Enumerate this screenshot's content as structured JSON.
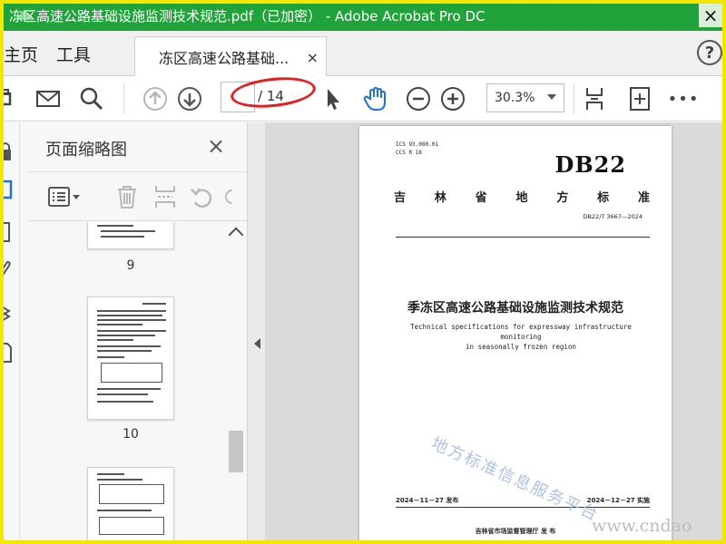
{
  "window": {
    "title": "冻区高速公路基础设施监测技术规范.pdf（已加密） - Adobe Acrobat Pro DC",
    "close_glyph": "×"
  },
  "menu": {
    "home": "主页",
    "tools": "工具"
  },
  "tab": {
    "label": "冻区高速公路基础...",
    "close_glyph": "×"
  },
  "help": {
    "label": "?"
  },
  "toolbar": {
    "page_input_value": "",
    "page_total": "/ 14",
    "zoom": "30.3%",
    "more": "•••"
  },
  "thumbnail_panel": {
    "title": "页面缩略图",
    "close_glyph": "×",
    "pages": [
      {
        "label": "9"
      },
      {
        "label": "10"
      }
    ]
  },
  "document": {
    "ics": "ICS  93.080.01",
    "ccs": "CCS  R 18",
    "header_code": "DB22",
    "province_chars": [
      "吉",
      "林",
      "省",
      "地",
      "方",
      "标",
      "准"
    ],
    "standard_number": "DB22/T 3667—2024",
    "title_cn": "季冻区高速公路基础设施监测技术规范",
    "title_en_1": "Technical specifications for expressway infrastructure monitoring",
    "title_en_2": "in seasonally frozen region",
    "release_date": "2024－11－27 发布",
    "implement_date": "2024－12－27 实施",
    "issuer": "吉林省市场监督管理厅    发  布",
    "watermark": "地方标准信息服务平台",
    "site_watermark": "www.cndao"
  },
  "colors": {
    "titlebar": "#20a33a",
    "frame": "#f5e600",
    "annotation_oval": "#e02020",
    "hand_tool": "#1f73d1",
    "watermark": "#9fb8e4"
  }
}
